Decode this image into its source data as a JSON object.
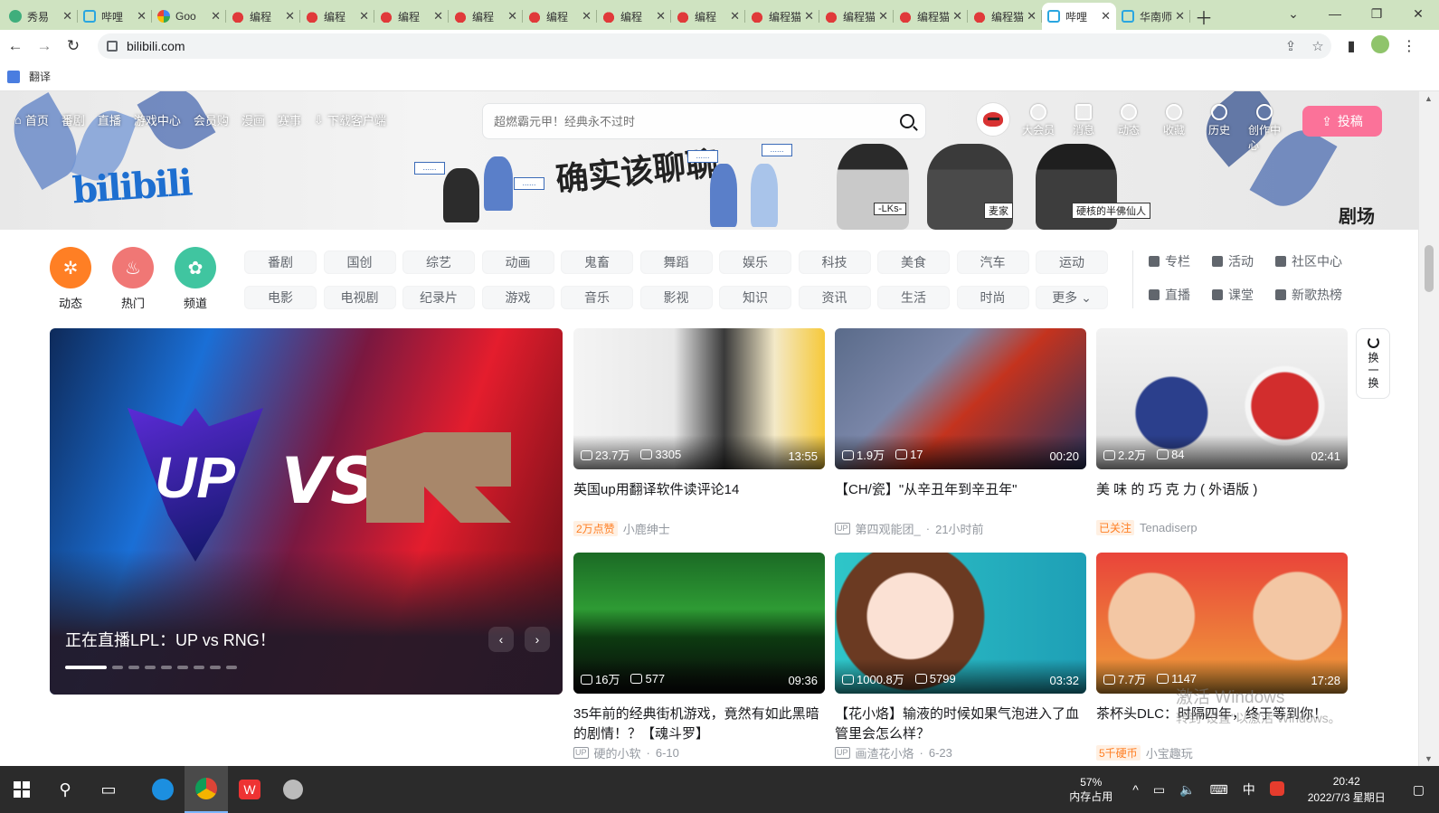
{
  "browser": {
    "tabs": [
      {
        "label": "秀易",
        "icon": "green"
      },
      {
        "label": "哔哩",
        "icon": "blue"
      },
      {
        "label": "Goo",
        "icon": "g"
      },
      {
        "label": "编程",
        "icon": "red"
      },
      {
        "label": "编程",
        "icon": "red"
      },
      {
        "label": "编程",
        "icon": "red"
      },
      {
        "label": "编程",
        "icon": "red"
      },
      {
        "label": "编程",
        "icon": "red"
      },
      {
        "label": "编程",
        "icon": "red"
      },
      {
        "label": "编程",
        "icon": "red"
      },
      {
        "label": "编程猫",
        "icon": "red"
      },
      {
        "label": "编程猫",
        "icon": "red"
      },
      {
        "label": "编程猫",
        "icon": "red"
      },
      {
        "label": "编程猫",
        "icon": "red"
      },
      {
        "label": "哔哩",
        "icon": "blue",
        "active": true
      },
      {
        "label": "华南师",
        "icon": "blue"
      }
    ],
    "url": "bilibili.com",
    "bookmark": "翻译"
  },
  "header": {
    "nav": [
      "首页",
      "番剧",
      "直播",
      "游戏中心",
      "会员购",
      "漫画",
      "赛事",
      "下载客户端"
    ],
    "search_placeholder": "超燃霸元甲！经典永不过时",
    "right_nav": [
      "大会员",
      "消息",
      "动态",
      "收藏",
      "历史",
      "创作中心"
    ],
    "upload_label": "投稿",
    "logo": "bilibili",
    "banner_title": "确实该聊聊",
    "banner_names": [
      "-LKs-",
      "麦家",
      "硬核的半佛仙人"
    ],
    "banner_side": "剧场",
    "bubble_text": "......"
  },
  "channels": {
    "circles": [
      {
        "label": "动态",
        "color": "#ff7f24",
        "glyph": "✲"
      },
      {
        "label": "热门",
        "color": "#f07775",
        "glyph": "♨"
      },
      {
        "label": "频道",
        "color": "#40c5a0",
        "glyph": "✿"
      }
    ],
    "tags": [
      "番剧",
      "国创",
      "综艺",
      "动画",
      "鬼畜",
      "舞蹈",
      "娱乐",
      "科技",
      "美食",
      "汽车",
      "运动",
      "电影",
      "电视剧",
      "纪录片",
      "游戏",
      "音乐",
      "影视",
      "知识",
      "资讯",
      "生活",
      "时尚",
      "更多 ⌄"
    ],
    "extras": [
      "专栏",
      "活动",
      "社区中心",
      "直播",
      "课堂",
      "新歌热榜"
    ]
  },
  "carousel": {
    "title": "正在直播LPL：UP vs RNG！",
    "vs_text": "VS",
    "up_text": "UP"
  },
  "refresh_label": "换一换",
  "videos": [
    {
      "plays": "23.7万",
      "danmaku": "3305",
      "duration": "13:55",
      "title": "英国up用翻译软件读评论14",
      "badge": "2万点赞",
      "author": "小鹿绅士",
      "date": "",
      "bg": "linear-gradient(90deg,#f4f4f4 0%,#e8e8e8 40%,#3a3a3a 60%,#f3e9c8 80%,#f6c93a 100%)"
    },
    {
      "plays": "1.9万",
      "danmaku": "17",
      "duration": "00:20",
      "title": "【CH/瓷】\"从辛丑年到辛丑年\"",
      "badge": "",
      "author": "第四观能团_",
      "date": "21小时前",
      "bg": "linear-gradient(135deg,#5a6b8a 0%,#7a86a8 35%,#c4331e 55%,#2a3560 100%)"
    },
    {
      "plays": "2.2万",
      "danmaku": "84",
      "duration": "02:41",
      "title": "美 味 的 巧 克 力 ( 外语版 )",
      "badge": "已关注",
      "author": "Tenadiserp",
      "date": "",
      "bg": "radial-gradient(circle at 30% 60%,#2b3f8c 0 18%,transparent 19%),radial-gradient(circle at 75% 55%,#d22d2d 0 16%,#f6f6f6 17% 19%,transparent 20%),linear-gradient(180deg,#f2f2f2,#dcdcdc)"
    },
    {
      "plays": "16万",
      "danmaku": "577",
      "duration": "09:36",
      "title": "35年前的经典街机游戏，竟然有如此黑暗的剧情！？【魂斗罗】",
      "badge": "",
      "author": "硬的小软",
      "date": "6-10",
      "bg": "linear-gradient(180deg,#1b6a25 0%,#2e9b34 40%,#0d3b11 60%,#0a0a0a 100%)"
    },
    {
      "plays": "1000.8万",
      "danmaku": "5799",
      "duration": "03:32",
      "title": "【花小烙】输液的时候如果气泡进入了血管里会怎么样？",
      "badge": "",
      "author": "画渣花小烙",
      "date": "6-23",
      "bg": "radial-gradient(circle at 30% 45%,#fbe1d4 0 22%,#6b3a22 23% 38%,transparent 39%),linear-gradient(90deg,#2fc6c9,#1e9fb6)"
    },
    {
      "plays": "7.7万",
      "danmaku": "1147",
      "duration": "17:28",
      "title": "茶杯头DLC：时隔四年，终于等到你！",
      "badge": "5千硬币",
      "author": "小宝趣玩",
      "date": "",
      "bg": "radial-gradient(circle at 22% 45%,#f3c7a4 0 20%,transparent 21%),radial-gradient(circle at 80% 45%,#f3c7a4 0 20%,transparent 21%),linear-gradient(180deg,#e9443a,#f0a13a)"
    }
  ],
  "watermark": {
    "line1": "激活 Windows",
    "line2": "转到\"设置\"以激活 Windows。"
  },
  "taskbar": {
    "mem_percent": "57%",
    "mem_label": "内存占用",
    "ime": "中",
    "time": "20:42",
    "date": "2022/7/3 星期日"
  }
}
